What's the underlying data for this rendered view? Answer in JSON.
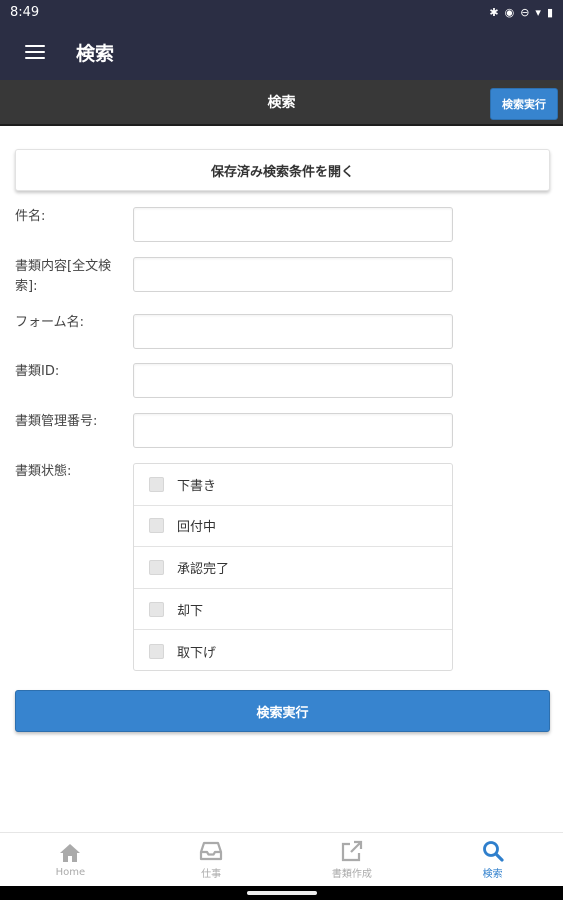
{
  "status_bar": {
    "time": "8:49"
  },
  "app_bar": {
    "title": "検索"
  },
  "sub_header": {
    "title": "検索",
    "exec_button": "検索実行"
  },
  "open_saved_button": "保存済み検索条件を開く",
  "form": {
    "subject_label": "件名:",
    "content_label": "書類内容[全文検索]:",
    "form_name_label": "フォーム名:",
    "doc_id_label": "書類ID:",
    "doc_number_label": "書類管理番号:",
    "doc_status_label": "書類状態:",
    "status_options": [
      "下書き",
      "回付中",
      "承認完了",
      "却下",
      "取下げ"
    ]
  },
  "exec_button": "検索実行",
  "bottom_nav": {
    "items": [
      {
        "label": "Home",
        "icon": "home-icon"
      },
      {
        "label": "仕事",
        "icon": "inbox-icon"
      },
      {
        "label": "書類作成",
        "icon": "external-link-icon"
      },
      {
        "label": "検索",
        "icon": "search-icon"
      }
    ],
    "active_index": 3
  },
  "colors": {
    "app_bar": "#2b2e44",
    "sub_header": "#383838",
    "primary": "#3784cf",
    "active_nav": "#2f7fcc",
    "inactive_nav": "#aaaaaa"
  }
}
